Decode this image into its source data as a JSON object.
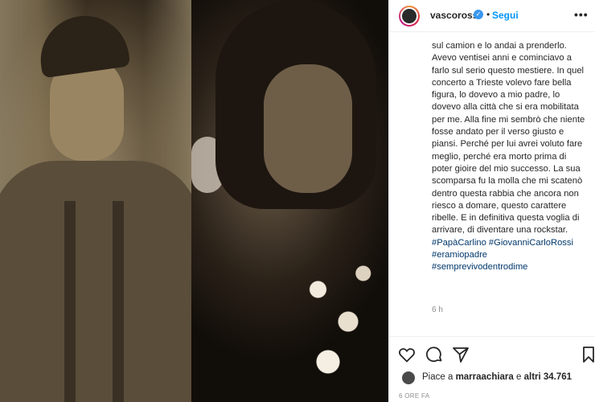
{
  "header": {
    "username": "vascorossi",
    "verified_glyph": "✓",
    "separator": "•",
    "follow_label": "Segui",
    "more_label": "•••"
  },
  "caption": {
    "text": "sul camion e lo andai a prenderlo.\nAvevo ventisei anni e cominciavo a\nfarlo sul serio questo mestiere. In quel\nconcerto a Trieste volevo fare bella\nfigura, lo dovevo a mio padre, lo\ndovevo alla città che si era mobilitata\nper me. Alla fine mi sembrò che niente\nfosse andato per il verso giusto e\npiansi. Perché per lui avrei voluto fare\nmeglio, perché era morto prima di\npoter gioire del mio successo. La sua\nscomparsa fu la molla che mi scatenò\ndentro questa rabbia che ancora non\nriesco a domare, questo carattere\nribelle. E in definitiva questa voglia di\narrivare, di diventare una rockstar.",
    "hashtags": "#PapàCarlino #GiovanniCarloRossi\n#eramiopadre\n#semprevivodentrodime",
    "time_ago": "6 h"
  },
  "actions": {
    "like_icon": "heart-icon",
    "comment_icon": "comment-icon",
    "share_icon": "share-icon",
    "save_icon": "bookmark-icon"
  },
  "likes": {
    "prefix": "Piace a ",
    "user": "marraachiara",
    "middle": " e ",
    "others": "altri 34.761"
  },
  "date": "6 ORE FA"
}
